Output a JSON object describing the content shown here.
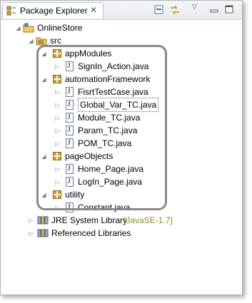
{
  "view": {
    "title": "Package Explorer",
    "close_symbol": "✕"
  },
  "toolbar": {
    "icons": [
      "collapse-all-icon",
      "link-with-editor-icon",
      "view-menu-icon",
      "minimize-icon",
      "maximize-icon"
    ]
  },
  "tree": {
    "project": "OnlineStore",
    "src": "src",
    "packages": [
      {
        "name": "appModules",
        "files": [
          "SignIn_Action.java"
        ]
      },
      {
        "name": "automationFramework",
        "files": [
          "FisrtTestCase.java",
          "Global_Var_TC.java",
          "Module_TC.java",
          "Param_TC.java",
          "POM_TC.java"
        ]
      },
      {
        "name": "pageObjects",
        "files": [
          "Home_Page.java",
          "LogIn_Page.java"
        ]
      },
      {
        "name": "utility",
        "files": [
          "Constant.java"
        ]
      }
    ],
    "jre": {
      "label": "JRE System Library",
      "decoration": "[JavaSE-1.7]"
    },
    "referenced": "Referenced Libraries"
  }
}
